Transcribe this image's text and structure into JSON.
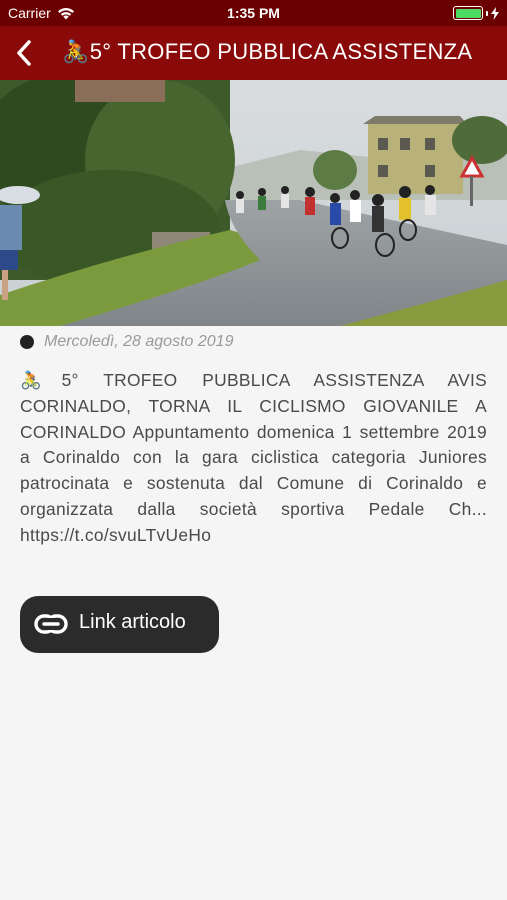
{
  "status_bar": {
    "carrier": "Carrier",
    "time": "1:35 PM"
  },
  "nav": {
    "back_icon": "chevron-left-icon",
    "title_emoji": "🚴",
    "title": "5° TROFEO PUBBLICA ASSISTENZA"
  },
  "article": {
    "image_alt": "Cyclists racing on a wet road",
    "date": "Mercoledì, 28 agosto 2019",
    "emoji": "🚴",
    "text": "5° TROFEO PUBBLICA ASSISTENZA AVIS CORINALDO, TORNA IL CICLISMO GIOVANILE A CORINALDO Appuntamento domenica 1 settembre 2019 a Corinaldo con la gara ciclistica categoria Juniores patrocinata e sostenuta dal Comune di Corinaldo e organizzata dalla società sportiva Pedale Ch... https://t.co/svuLTvUeHo",
    "link_label": "Link articolo",
    "link_icon": "link-icon"
  },
  "colors": {
    "nav_bg": "#8a0a0a",
    "status_bg": "#6b0000",
    "button_bg": "#2b2b2b"
  }
}
